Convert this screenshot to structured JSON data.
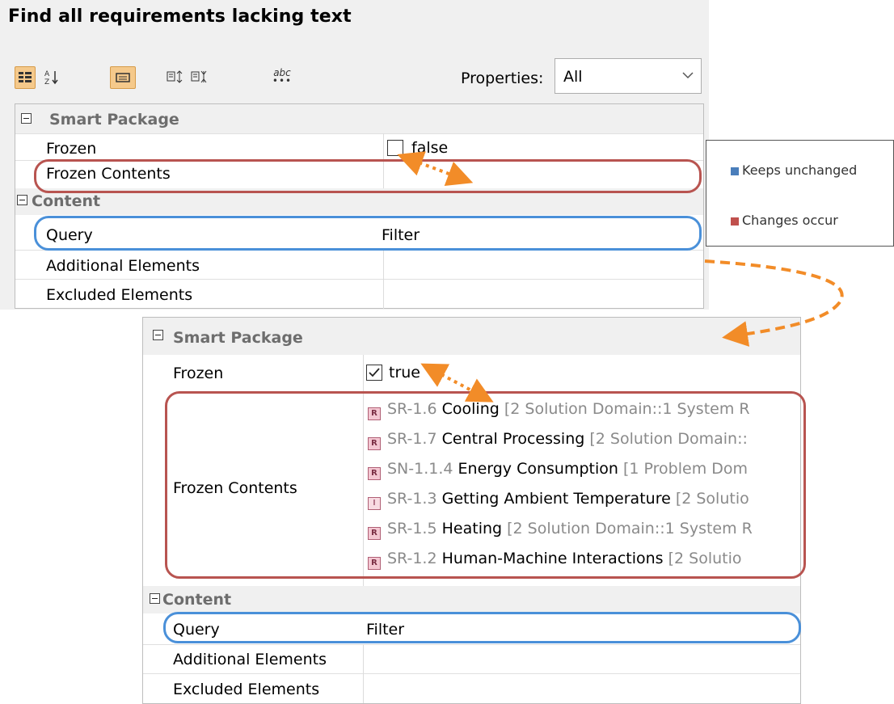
{
  "title": "Find all requirements lacking text",
  "toolbar": {
    "properties_label": "Properties:",
    "properties_value": "All",
    "abc_label": "abc"
  },
  "top_grid": {
    "category1": "Smart Package",
    "frozen_label": "Frozen",
    "frozen_value": "false",
    "frozen_contents_label": "Frozen Contents",
    "category2": "Content",
    "query_label": "Query",
    "query_value": "Filter",
    "additional_label": "Additional Elements",
    "excluded_label": "Excluded Elements"
  },
  "legend": {
    "unchanged": "Keeps unchanged",
    "changes": "Changes occur",
    "unchanged_color": "#4a7ebb",
    "changes_color": "#c0504d"
  },
  "bottom_grid": {
    "category1": "Smart Package",
    "frozen_label": "Frozen",
    "frozen_value": "true",
    "frozen_contents_label": "Frozen Contents",
    "requirements": [
      {
        "icon": "R",
        "id": "SR-1.6",
        "name": "Cooling",
        "path": "[2 Solution Domain::1 System R"
      },
      {
        "icon": "R",
        "id": "SR-1.7",
        "name": "Central Processing",
        "path": "[2 Solution Domain::"
      },
      {
        "icon": "R",
        "id": "SN-1.1.4",
        "name": "Energy Consumption",
        "path": "[1 Problem Dom"
      },
      {
        "icon": "I",
        "id": "SR-1.3",
        "name": "Getting Ambient Temperature",
        "path": "[2 Solutio"
      },
      {
        "icon": "R",
        "id": "SR-1.5",
        "name": "Heating",
        "path": "[2 Solution Domain::1 System R"
      },
      {
        "icon": "R",
        "id": "SR-1.2",
        "name": "Human-Machine Interactions",
        "path": "[2 Solutio"
      }
    ],
    "category2": "Content",
    "query_label": "Query",
    "query_value": "Filter",
    "additional_label": "Additional Elements",
    "excluded_label": "Excluded Elements"
  },
  "colors": {
    "accent_orange": "#f28c28",
    "oval_red": "#b85450",
    "oval_blue": "#4a90d9"
  }
}
